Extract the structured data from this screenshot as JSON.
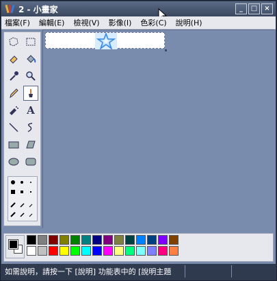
{
  "window": {
    "title": "2 - 小畫家",
    "minimize_label": "_",
    "maximize_label": "□",
    "close_label": "×"
  },
  "menu": [
    {
      "label": "檔案(F)"
    },
    {
      "label": "編輯(E)"
    },
    {
      "label": "檢視(V)"
    },
    {
      "label": "影像(I)"
    },
    {
      "label": "色彩(C)"
    },
    {
      "label": "說明(H)"
    }
  ],
  "tools": [
    {
      "name": "free-select-icon"
    },
    {
      "name": "rect-select-icon"
    },
    {
      "name": "eraser-icon"
    },
    {
      "name": "fill-bucket-icon"
    },
    {
      "name": "color-picker-icon"
    },
    {
      "name": "magnifier-icon"
    },
    {
      "name": "pencil-icon"
    },
    {
      "name": "brush-icon",
      "active": true
    },
    {
      "name": "airbrush-icon"
    },
    {
      "name": "text-icon",
      "glyph": "A"
    },
    {
      "name": "line-icon"
    },
    {
      "name": "curve-icon"
    },
    {
      "name": "rectangle-icon"
    },
    {
      "name": "polygon-icon"
    },
    {
      "name": "ellipse-icon"
    },
    {
      "name": "rounded-rect-icon"
    }
  ],
  "palette_colors": [
    "#000000",
    "#808080",
    "#800000",
    "#808000",
    "#008000",
    "#008080",
    "#000080",
    "#800080",
    "#808040",
    "#004040",
    "#0080ff",
    "#004080",
    "#8000ff",
    "#804000",
    "#ffffff",
    "#c0c0c0",
    "#ff0000",
    "#ffff00",
    "#00ff00",
    "#00ffff",
    "#0000ff",
    "#ff00ff",
    "#ffff80",
    "#00ff80",
    "#80ffff",
    "#8080ff",
    "#ff0080",
    "#ff8040"
  ],
  "foreground_color": "#000000",
  "background_color": "#ffffff",
  "status": {
    "text": "如需說明，請按一下 [說明] 功能表中的 [說明主題"
  }
}
